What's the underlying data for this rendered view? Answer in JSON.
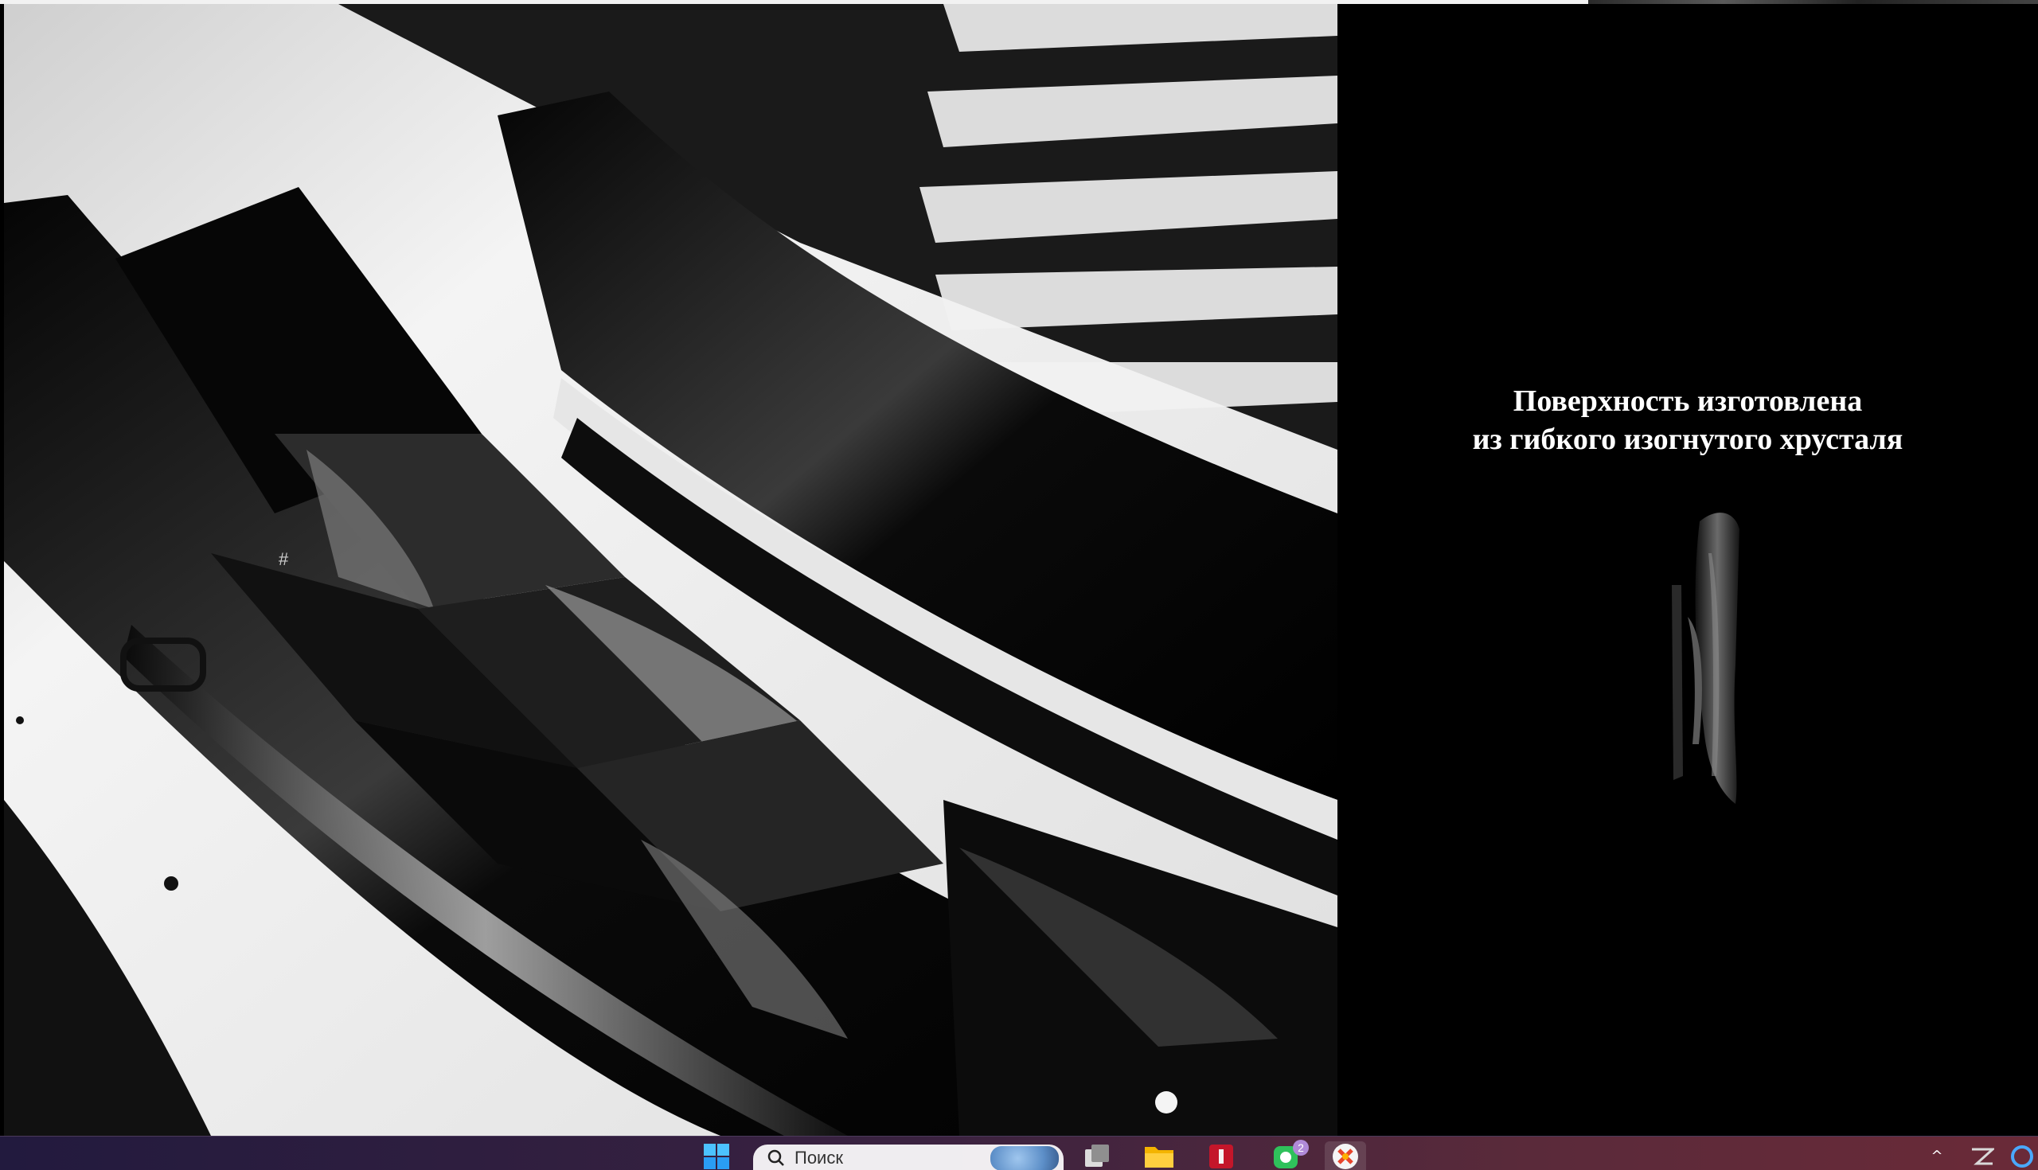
{
  "caption": {
    "line1": "Поверхность изготовлена",
    "line2": "из гибкого изогнутого хрусталя"
  },
  "photo": {
    "subject": "keyboard-keys-photo-icon"
  },
  "product": {
    "subject": "sculpture-thumbnail-icon"
  },
  "taskbar": {
    "start": "windows-start-icon",
    "search_placeholder": "Поиск",
    "search_icon": "search-icon",
    "task_view": "task-view-icon",
    "explorer": "folder-icon",
    "red_app": "red-app-icon",
    "green_app": "chat-app-icon",
    "green_app_badge": "2",
    "browser": "browser-icon",
    "tray_chevron": "^"
  },
  "colors": {
    "background": "#000000",
    "caption_text": "#ffffff",
    "taskbar_start": "#221a3e",
    "taskbar_end": "#6a2a38",
    "badge": "#b08ad8"
  }
}
